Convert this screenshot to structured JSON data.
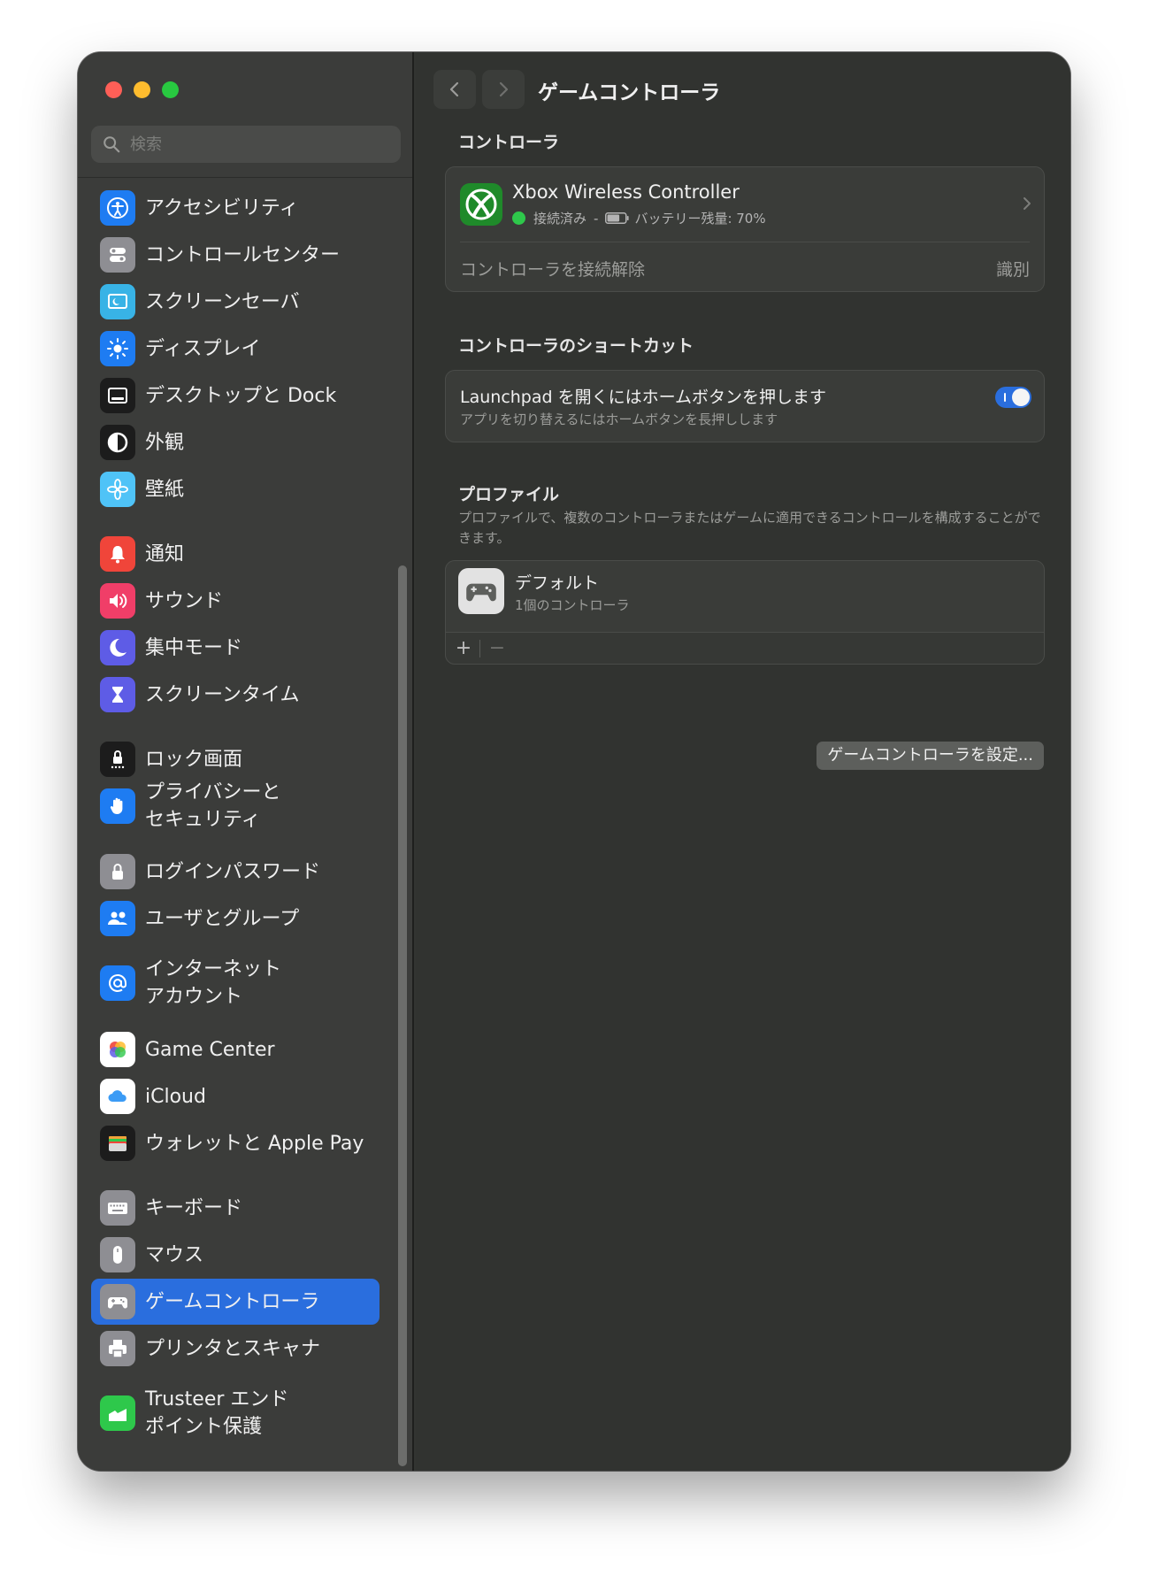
{
  "window": {
    "title": "ゲームコントローラ"
  },
  "search": {
    "placeholder": "検索"
  },
  "sidebar": {
    "items": [
      {
        "label": "アクセシビリティ",
        "icon": "accessibility-icon",
        "color": "#1e7cf2"
      },
      {
        "label": "コントロールセンター",
        "icon": "control-center-icon",
        "color": "#8e8e93"
      },
      {
        "label": "スクリーンセーバ",
        "icon": "screen-saver-icon",
        "color": "#38b3e6"
      },
      {
        "label": "ディスプレイ",
        "icon": "display-icon",
        "color": "#1e7cf2"
      },
      {
        "label": "デスクトップと Dock",
        "icon": "desktop-dock-icon",
        "color": "#1c1c1c"
      },
      {
        "label": "外観",
        "icon": "appearance-icon",
        "color": "#1c1c1c"
      },
      {
        "label": "壁紙",
        "icon": "wallpaper-icon",
        "color": "#4fc3f7"
      },
      {
        "label": "通知",
        "icon": "notifications-icon",
        "color": "#f0453a"
      },
      {
        "label": "サウンド",
        "icon": "sound-icon",
        "color": "#f03e68"
      },
      {
        "label": "集中モード",
        "icon": "focus-icon",
        "color": "#5e5ce6"
      },
      {
        "label": "スクリーンタイム",
        "icon": "screen-time-icon",
        "color": "#5e5ce6"
      },
      {
        "label": "ロック画面",
        "icon": "lock-screen-icon",
        "color": "#1c1c1c"
      },
      {
        "label": "プライバシーと\nセキュリティ",
        "icon": "privacy-hand-icon",
        "color": "#1e7cf2"
      },
      {
        "label": "ログインパスワード",
        "icon": "lock-icon",
        "color": "#8e8e93"
      },
      {
        "label": "ユーザとグループ",
        "icon": "users-icon",
        "color": "#1e7cf2"
      },
      {
        "label": "インターネット\nアカウント",
        "icon": "at-sign-icon",
        "color": "#1e7cf2"
      },
      {
        "label": "Game Center",
        "icon": "game-center-icon",
        "color": "#ffffff"
      },
      {
        "label": "iCloud",
        "icon": "icloud-icon",
        "color": "#ffffff"
      },
      {
        "label": "ウォレットと Apple Pay",
        "icon": "wallet-icon",
        "color": "#1c1c1c"
      },
      {
        "label": "キーボード",
        "icon": "keyboard-icon",
        "color": "#8e8e93"
      },
      {
        "label": "マウス",
        "icon": "mouse-icon",
        "color": "#8e8e93"
      },
      {
        "label": "ゲームコントローラ",
        "icon": "gamepad-icon",
        "color": "#8e8e93",
        "selected": true
      },
      {
        "label": "プリンタとスキャナ",
        "icon": "printer-icon",
        "color": "#8e8e93"
      },
      {
        "label": "Trusteer エンド\nポイント保護",
        "icon": "trusteer-icon",
        "color": "#2ec84b"
      }
    ]
  },
  "main": {
    "controllers_section": "コントローラ",
    "controller": {
      "name": "Xbox Wireless Controller",
      "status": "接続済み",
      "separator": "-",
      "battery_label": "バッテリー残量: 70%",
      "battery_level": 0.7,
      "disconnect_label": "コントローラを接続解除",
      "identify_label": "識別"
    },
    "shortcuts_section": "コントローラのショートカット",
    "shortcut": {
      "title": "Launchpad を開くにはホームボタンを押します",
      "subtitle": "アプリを切り替えるにはホームボタンを長押しします",
      "enabled": true
    },
    "profiles_section": "プロファイル",
    "profiles_description": "プロファイルで、複数のコントローラまたはゲームに適用できるコントロールを構成することができます。",
    "profile": {
      "name": "デフォルト",
      "subtitle": "1個のコントローラ"
    },
    "add_label": "+",
    "remove_label": "−",
    "setup_button": "ゲームコントローラを設定..."
  },
  "colors": {
    "accent": "#2a6ede",
    "status_green": "#2ec84b",
    "xbox_green": "#1f8a2a"
  }
}
